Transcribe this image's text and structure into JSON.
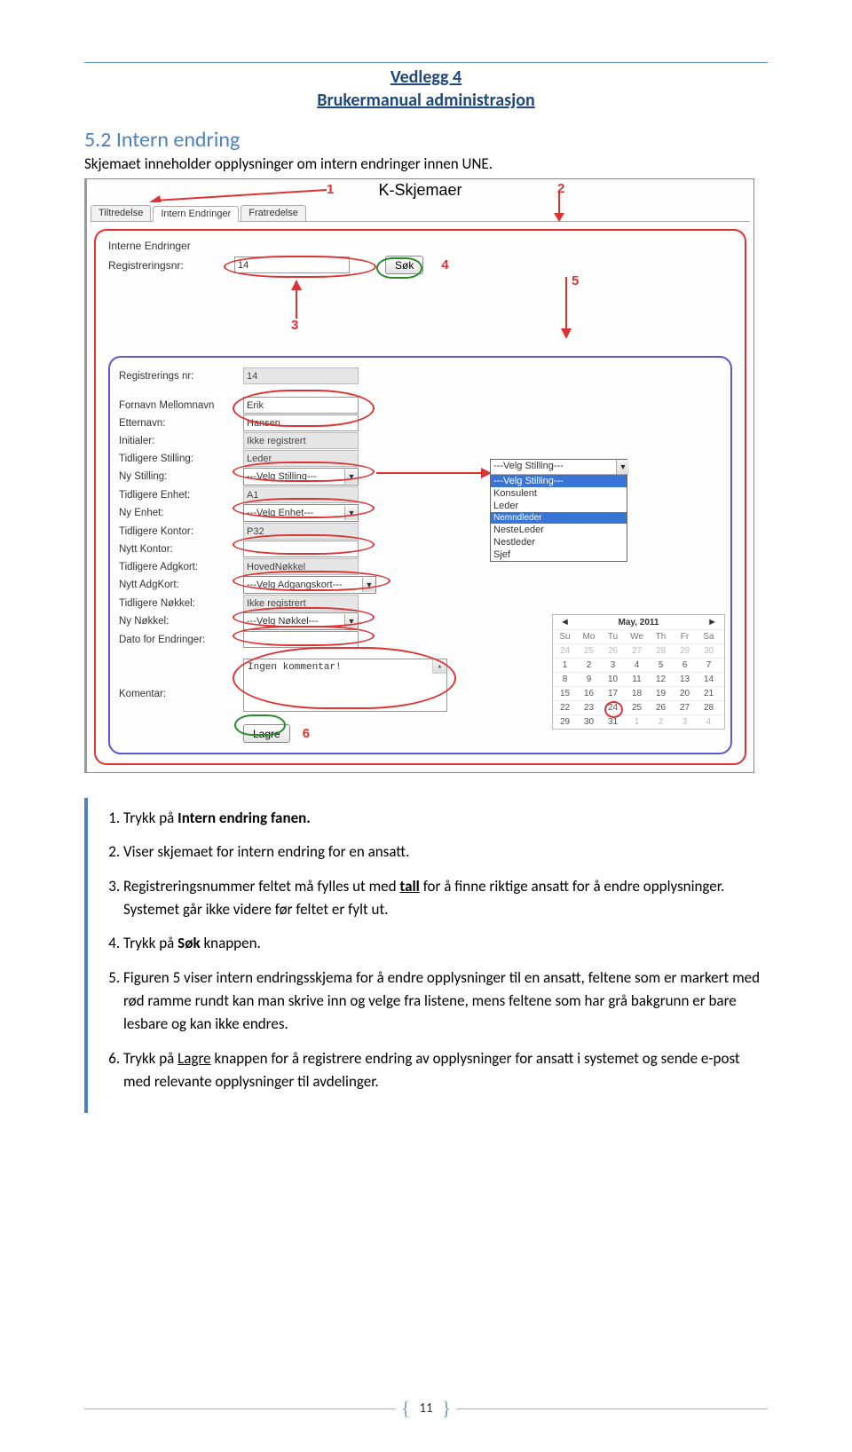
{
  "header": {
    "title": "Vedlegg 4",
    "subtitle": "Brukermanual administrasjon"
  },
  "section": {
    "number": "5.2 Intern endring",
    "intro": "Skjemaet inneholder opplysninger om intern endringer innen UNE."
  },
  "screenshot": {
    "title": "K-Skjemaer",
    "tabs": [
      "Tiltredelse",
      "Intern Endringer",
      "Fratredelse"
    ],
    "panel_title": "Interne Endringer",
    "reg_label": "Registreringsnr:",
    "reg_value": "14",
    "sok_btn": "Søk",
    "annotations": {
      "a1": "1",
      "a2": "2",
      "a3": "3",
      "a4": "4",
      "a5": "5",
      "a6": "6"
    },
    "form": {
      "regnr_label": "Registrerings nr:",
      "regnr_value": "14",
      "fornavn_label": "Fornavn Mellomnavn",
      "fornavn_value": "Erik",
      "etternavn_label": "Etternavn:",
      "etternavn_value": "Hansen",
      "initialer_label": "Initialer:",
      "initialer_value": "Ikke registrert",
      "tidlstilling_label": "Tidligere Stilling:",
      "tidlstilling_value": "Leder",
      "nystilling_label": "Ny Stilling:",
      "nystilling_value": "---Velg Stilling---",
      "tidlenhet_label": "Tidligere Enhet:",
      "tidlenhet_value": "A1",
      "nyenhet_label": "Ny Enhet:",
      "nyenhet_value": "---Velg Enhet---",
      "tidlkontor_label": "Tidligere Kontor:",
      "tidlkontor_value": "P32",
      "nyttkontor_label": "Nytt Kontor:",
      "nyttkontor_value": "",
      "tidladgkort_label": "Tidligere Adgkort:",
      "tidladgkort_value": "HovedNøkkel",
      "nyttadgkort_label": "Nytt AdgKort:",
      "nyttadgkort_value": "---Velg Adgangskort---",
      "tidlnokkel_label": "Tidligere Nøkkel:",
      "tidlnokkel_value": "Ikke registrert",
      "nynokkel_label": "Ny Nøkkel:",
      "nynokkel_value": "---Velg Nøkkel---",
      "dato_label": "Dato for Endringer:",
      "komentar_label": "Komentar:",
      "komentar_value": "Ingen kommentar!",
      "lagre_btn": "Lagre"
    },
    "dropdown": {
      "head": "---Velg Stilling---",
      "selected": "---Velg Stilling---",
      "opts": [
        "Konsulent",
        "Leder",
        "Nemndleder",
        "NesteLeder",
        "Nestleder",
        "Sjef"
      ]
    },
    "calendar": {
      "title": "May, 2011",
      "dow": [
        "Su",
        "Mo",
        "Tu",
        "We",
        "Th",
        "Fr",
        "Sa"
      ],
      "rows": [
        [
          "24",
          "25",
          "26",
          "27",
          "28",
          "29",
          "30"
        ],
        [
          "1",
          "2",
          "3",
          "4",
          "5",
          "6",
          "7"
        ],
        [
          "8",
          "9",
          "10",
          "11",
          "12",
          "13",
          "14"
        ],
        [
          "15",
          "16",
          "17",
          "18",
          "19",
          "20",
          "21"
        ],
        [
          "22",
          "23",
          "24",
          "25",
          "26",
          "27",
          "28"
        ],
        [
          "29",
          "30",
          "31",
          "1",
          "2",
          "3",
          "4"
        ]
      ]
    }
  },
  "instructions": {
    "i1a": "Trykk på ",
    "i1b": "Intern endring fanen.",
    "i2": "Viser skjemaet for intern endring for en ansatt.",
    "i3a": "Registreringsnummer feltet må fylles ut med ",
    "i3u": "tall",
    "i3b": " for å finne riktige ansatt for å endre opplysninger. Systemet går ikke videre før feltet er fylt ut.",
    "i4a": "Trykk på ",
    "i4b": "Søk",
    "i4c": " knappen.",
    "i5": "Figuren 5 viser intern endringsskjema for å endre opplysninger til en ansatt, feltene som er markert med rød ramme rundt kan man skrive inn og velge fra listene, mens feltene som har grå bakgrunn er bare lesbare og kan ikke endres.",
    "i6a": "Trykk på ",
    "i6u": "Lagre",
    "i6b": " knappen for å registrere endring av opplysninger for ansatt i systemet og sende e-post med relevante opplysninger til avdelinger."
  },
  "footer": {
    "page": "11"
  }
}
